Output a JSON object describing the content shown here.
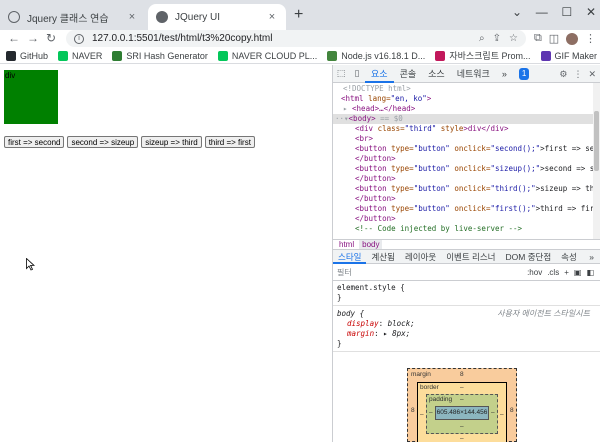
{
  "tabs": [
    {
      "title": "Jquery 클래스 연습",
      "active": false
    },
    {
      "title": "JQuery UI",
      "active": true
    }
  ],
  "tab_icons": {
    "new_tab": "+",
    "close": "×",
    "list": "⌄",
    "minimize": "—",
    "maximize": "☐",
    "window_close": "✕"
  },
  "toolbar": {
    "url": "127.0.0.1:5501/test/html/t3%20copy.html",
    "back": "←",
    "forward": "→",
    "reload": "↻",
    "info": "i",
    "zoom_icon": "⌕",
    "share_icon": "⇪",
    "star_icon": "☆",
    "extensions_icon": "⧉",
    "sidebar_icon": "◫",
    "menu_icon": "⋮"
  },
  "bookmarks": [
    {
      "label": "GitHub",
      "color": "#24292e"
    },
    {
      "label": "NAVER",
      "color": "#03c75a"
    },
    {
      "label": "SRI Hash Generator",
      "color": "#2e7d32"
    },
    {
      "label": "NAVER CLOUD PL...",
      "color": "#03c75a"
    },
    {
      "label": "Node.js v16.18.1 D...",
      "color": "#43853d"
    },
    {
      "label": "자바스크립트 Prom...",
      "color": "#c2185b"
    },
    {
      "label": "GIF Maker",
      "color": "#5e35b1"
    }
  ],
  "page": {
    "box_label": "div",
    "box_color": "#008000",
    "buttons": [
      "first => second",
      "second => sizeup",
      "sizeup => third",
      "third => first"
    ]
  },
  "devtools": {
    "tabs": [
      "요소",
      "콘솔",
      "소스",
      "네트워크"
    ],
    "more": "»",
    "issues_badge": "1",
    "dom_lines": {
      "l0": "<!DOCTYPE html>",
      "l1_tag_open": "<html",
      "l1_attr": " lang=",
      "l1_val": "\"en, ko\"",
      "l1_close": ">",
      "l2": "<head>…</head>",
      "l3_tag": "<body>",
      "l3_eq": " == $0",
      "l4_tag": "<div",
      "l4_attr1": " class=",
      "l4_val1": "\"third\"",
      "l4_attr2": " style",
      "l4_rest": ">div</div>",
      "l5": "<br>",
      "b1_open": "<button",
      "b1_attr1": " type=",
      "b1_val1": "\"button\"",
      "b1_attr2": " onclick=",
      "b1_val2": "\"second();\"",
      "b1_text": ">first => second",
      "b1_close": "</button>",
      "b2_val2": "\"sizeup();\"",
      "b2_text": ">second => sizeup",
      "b3_val2": "\"third();\"",
      "b3_text": ">sizeup => third",
      "b4_val2": "\"first();\"",
      "b4_text": ">third => first",
      "comment": "<!-- Code injected by live-server -->"
    },
    "breadcrumbs": [
      "html",
      "body"
    ],
    "style_tabs": [
      "스타일",
      "계산됨",
      "레이아웃",
      "이벤트 리스너",
      "DOM 중단점",
      "속성"
    ],
    "filter_placeholder": "필터",
    "filter_tools": [
      ":hov",
      ".cls",
      "+"
    ],
    "rules": {
      "element_style": "element.style {",
      "close": "}",
      "body_sel": "body {",
      "ua_label": "사용자 에이전트 스타일시트",
      "p1_name": "display",
      "p1_val": "block;",
      "p2_name": "margin",
      "p2_val": "▸ 8px;"
    },
    "box_model": {
      "margin_label": "margin",
      "margin_top": "8",
      "margin_left": "8",
      "margin_right": "8",
      "border_label": "border",
      "border_top": "–",
      "padding_label": "padding",
      "padding_top": "–",
      "content": "605.486×144.456",
      "padding_bottom": "–",
      "border_bottom": "–",
      "dash": "–"
    }
  }
}
